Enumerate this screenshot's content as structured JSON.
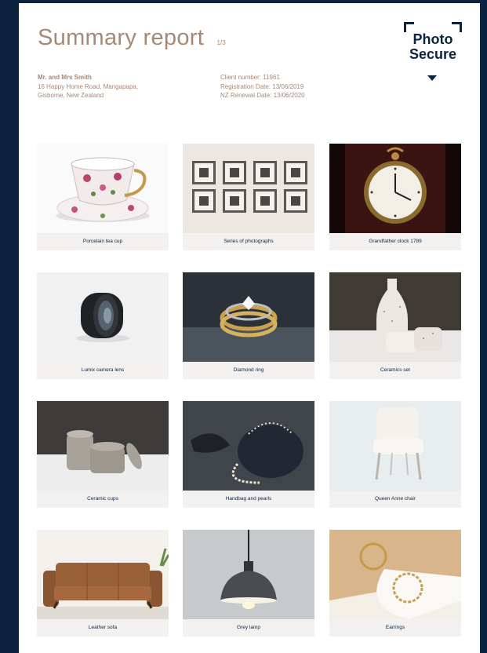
{
  "report": {
    "title": "Summary report",
    "page_indicator": "1/3"
  },
  "brand": {
    "line1": "Photo",
    "line2": "Secure",
    "color": "#0c2340"
  },
  "client": {
    "name": "Mr. and Mrs Smith",
    "address_line1": "16 Happy Home Road, Mangapapa,",
    "address_line2": "Gisborne, New Zealand",
    "client_number": "Client number: 11961",
    "registration_date": "Registration Date: 13/06/2019",
    "renewal_date": "NZ Renewal Date: 13/06/2020"
  },
  "items": [
    {
      "caption": "Porcelain tea cup",
      "image": "teacup-photo"
    },
    {
      "caption": "Series of photographs",
      "image": "framed-photos-photo"
    },
    {
      "caption": "Grandfather clock 1789",
      "image": "pocket-watch-photo"
    },
    {
      "caption": "Lumix camera lens",
      "image": "camera-lens-photo"
    },
    {
      "caption": "Diamond ring",
      "image": "diamond-ring-photo"
    },
    {
      "caption": "Ceramics set",
      "image": "ceramics-photo"
    },
    {
      "caption": "Ceramic cups",
      "image": "ceramic-cups-photo"
    },
    {
      "caption": "Handbag and pearls",
      "image": "handbag-pearls-photo"
    },
    {
      "caption": "Queen Anne chair",
      "image": "queen-anne-chair-photo"
    },
    {
      "caption": "Leather sofa",
      "image": "leather-sofa-photo"
    },
    {
      "caption": "Grey lamp",
      "image": "grey-lamp-photo"
    },
    {
      "caption": "Earrings",
      "image": "earrings-photo"
    }
  ],
  "colors": {
    "accent": "#a68875",
    "background": "#0c2340",
    "caption_bg": "#f3f1ef"
  }
}
